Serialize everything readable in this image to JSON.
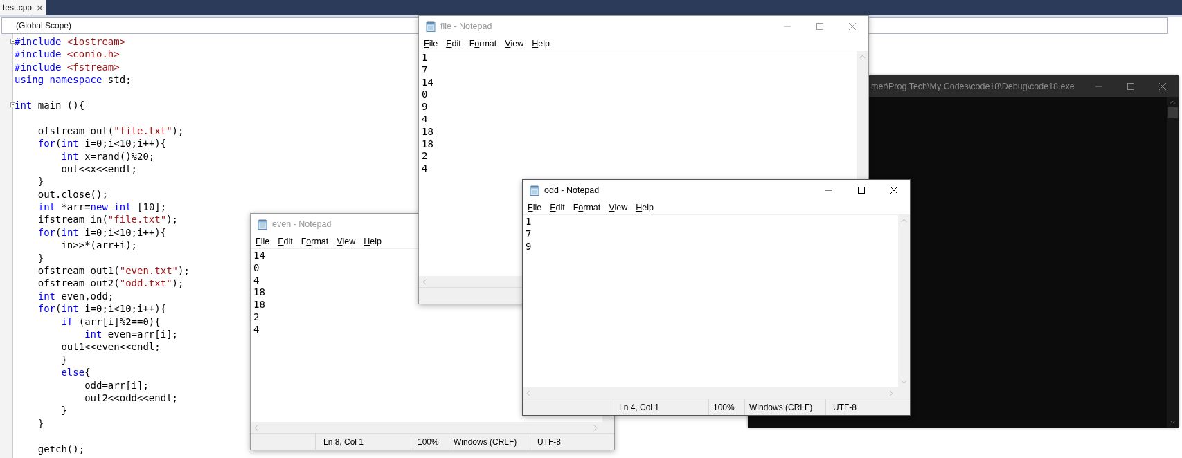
{
  "editor": {
    "tab": {
      "label": "test.cpp",
      "selected": true
    },
    "scope": "(Global Scope)",
    "lines": [
      {
        "gap": false,
        "fold": true,
        "tokens": [
          {
            "text": "#include",
            "kind": "keyword"
          },
          {
            "text": " <iostream>",
            "kind": "string"
          }
        ]
      },
      {
        "gap": false,
        "fold": false,
        "tokens": [
          {
            "text": "#include",
            "kind": "keyword"
          },
          {
            "text": " <conio.h>",
            "kind": "string"
          }
        ]
      },
      {
        "gap": false,
        "fold": false,
        "tokens": [
          {
            "text": "#include",
            "kind": "keyword"
          },
          {
            "text": " <fstream>",
            "kind": "string"
          }
        ]
      },
      {
        "gap": false,
        "fold": false,
        "tokens": [
          {
            "text": "using namespace",
            "kind": "keyword"
          },
          {
            "text": " std;",
            "kind": "plain"
          }
        ]
      },
      {
        "gap": true,
        "fold": true,
        "tokens": [
          {
            "text": "int",
            "kind": "keyword"
          },
          {
            "text": " main (){",
            "kind": "plain"
          }
        ]
      },
      {
        "gap": true,
        "fold": false,
        "tokens": [
          {
            "text": "    ofstream out(",
            "kind": "plain"
          },
          {
            "text": "\"file.txt\"",
            "kind": "string"
          },
          {
            "text": ");",
            "kind": "plain"
          }
        ]
      },
      {
        "gap": false,
        "fold": false,
        "tokens": [
          {
            "text": "    for",
            "kind": "keyword"
          },
          {
            "text": "(",
            "kind": "plain"
          },
          {
            "text": "int",
            "kind": "keyword"
          },
          {
            "text": " i=0;i<10;i++){",
            "kind": "plain"
          }
        ]
      },
      {
        "gap": false,
        "fold": false,
        "tokens": [
          {
            "text": "        int",
            "kind": "keyword"
          },
          {
            "text": " x=rand()%20;",
            "kind": "plain"
          }
        ]
      },
      {
        "gap": false,
        "fold": false,
        "tokens": [
          {
            "text": "        out<<x<<endl;",
            "kind": "plain"
          }
        ]
      },
      {
        "gap": false,
        "fold": false,
        "tokens": [
          {
            "text": "    }",
            "kind": "plain"
          }
        ]
      },
      {
        "gap": false,
        "fold": false,
        "tokens": [
          {
            "text": "    out.close();",
            "kind": "plain"
          }
        ]
      },
      {
        "gap": false,
        "fold": false,
        "tokens": [
          {
            "text": "    int",
            "kind": "keyword"
          },
          {
            "text": " *arr=",
            "kind": "plain"
          },
          {
            "text": "new int",
            "kind": "keyword"
          },
          {
            "text": " [10];",
            "kind": "plain"
          }
        ]
      },
      {
        "gap": false,
        "fold": false,
        "tokens": [
          {
            "text": "    ifstream in(",
            "kind": "plain"
          },
          {
            "text": "\"file.txt\"",
            "kind": "string"
          },
          {
            "text": ");",
            "kind": "plain"
          }
        ]
      },
      {
        "gap": false,
        "fold": false,
        "tokens": [
          {
            "text": "    for",
            "kind": "keyword"
          },
          {
            "text": "(",
            "kind": "plain"
          },
          {
            "text": "int",
            "kind": "keyword"
          },
          {
            "text": " i=0;i<10;i++){",
            "kind": "plain"
          }
        ]
      },
      {
        "gap": false,
        "fold": false,
        "tokens": [
          {
            "text": "        in>>*(arr+i);",
            "kind": "plain"
          }
        ]
      },
      {
        "gap": false,
        "fold": false,
        "tokens": [
          {
            "text": "    }",
            "kind": "plain"
          }
        ]
      },
      {
        "gap": false,
        "fold": false,
        "tokens": [
          {
            "text": "    ofstream out1(",
            "kind": "plain"
          },
          {
            "text": "\"even.txt\"",
            "kind": "string"
          },
          {
            "text": ");",
            "kind": "plain"
          }
        ]
      },
      {
        "gap": false,
        "fold": false,
        "tokens": [
          {
            "text": "    ofstream out2(",
            "kind": "plain"
          },
          {
            "text": "\"odd.txt\"",
            "kind": "string"
          },
          {
            "text": ");",
            "kind": "plain"
          }
        ]
      },
      {
        "gap": false,
        "fold": false,
        "tokens": [
          {
            "text": "    int",
            "kind": "keyword"
          },
          {
            "text": " even,odd;",
            "kind": "plain"
          }
        ]
      },
      {
        "gap": false,
        "fold": false,
        "tokens": [
          {
            "text": "    for",
            "kind": "keyword"
          },
          {
            "text": "(",
            "kind": "plain"
          },
          {
            "text": "int",
            "kind": "keyword"
          },
          {
            "text": " i=0;i<10;i++){",
            "kind": "plain"
          }
        ]
      },
      {
        "gap": false,
        "fold": false,
        "tokens": [
          {
            "text": "        if",
            "kind": "keyword"
          },
          {
            "text": " (arr[i]%2==0){",
            "kind": "plain"
          }
        ]
      },
      {
        "gap": false,
        "fold": false,
        "tokens": [
          {
            "text": "            int",
            "kind": "keyword"
          },
          {
            "text": " even=arr[i];",
            "kind": "plain"
          }
        ]
      },
      {
        "gap": false,
        "fold": false,
        "tokens": [
          {
            "text": "        out1<<even<<endl;",
            "kind": "plain"
          }
        ]
      },
      {
        "gap": false,
        "fold": false,
        "tokens": [
          {
            "text": "        }",
            "kind": "plain"
          }
        ]
      },
      {
        "gap": false,
        "fold": false,
        "tokens": [
          {
            "text": "        else",
            "kind": "keyword"
          },
          {
            "text": "{",
            "kind": "plain"
          }
        ]
      },
      {
        "gap": false,
        "fold": false,
        "tokens": [
          {
            "text": "            odd=arr[i];",
            "kind": "plain"
          }
        ]
      },
      {
        "gap": false,
        "fold": false,
        "tokens": [
          {
            "text": "            out2<<odd<<endl;",
            "kind": "plain"
          }
        ]
      },
      {
        "gap": false,
        "fold": false,
        "tokens": [
          {
            "text": "        }",
            "kind": "plain"
          }
        ]
      },
      {
        "gap": false,
        "fold": false,
        "tokens": [
          {
            "text": "    }",
            "kind": "plain"
          }
        ]
      },
      {
        "gap": true,
        "fold": false,
        "tokens": [
          {
            "text": "    getch();",
            "kind": "plain"
          }
        ]
      }
    ]
  },
  "console": {
    "title": "mer\\Prog Tech\\My Codes\\code18\\Debug\\code18.exe",
    "active": false
  },
  "notepads": [
    {
      "title": "odd - Notepad",
      "active": true,
      "menu": [
        {
          "key": "F",
          "post": "ile"
        },
        {
          "key": "E",
          "post": "dit"
        },
        {
          "pre": "F",
          "key": "o",
          "post": "rmat"
        },
        {
          "key": "V",
          "post": "iew"
        },
        {
          "key": "H",
          "post": "elp"
        }
      ],
      "lines": [
        "1",
        "7",
        "9"
      ],
      "status": {
        "position": "Ln 4, Col 1",
        "zoom": "100%",
        "line_ending": "Windows (CRLF)",
        "encoding": "UTF-8"
      }
    },
    {
      "title": "file - Notepad",
      "active": false,
      "menu": [
        {
          "key": "F",
          "post": "ile"
        },
        {
          "key": "E",
          "post": "dit"
        },
        {
          "pre": "F",
          "key": "o",
          "post": "rmat"
        },
        {
          "key": "V",
          "post": "iew"
        },
        {
          "key": "H",
          "post": "elp"
        }
      ],
      "lines": [
        "1",
        "7",
        "14",
        "0",
        "9",
        "4",
        "18",
        "18",
        "2",
        "4"
      ]
    },
    {
      "title": "even - Notepad",
      "active": false,
      "menu": [
        {
          "key": "F",
          "post": "ile"
        },
        {
          "key": "E",
          "post": "dit"
        },
        {
          "pre": "F",
          "key": "o",
          "post": "rmat"
        },
        {
          "key": "V",
          "post": "iew"
        },
        {
          "key": "H",
          "post": "elp"
        }
      ],
      "lines": [
        "14",
        "0",
        "4",
        "18",
        "18",
        "2",
        "4"
      ],
      "status": {
        "position": "Ln 8, Col 1",
        "zoom": "100%",
        "line_ending": "Windows (CRLF)",
        "encoding": "UTF-8"
      }
    }
  ]
}
